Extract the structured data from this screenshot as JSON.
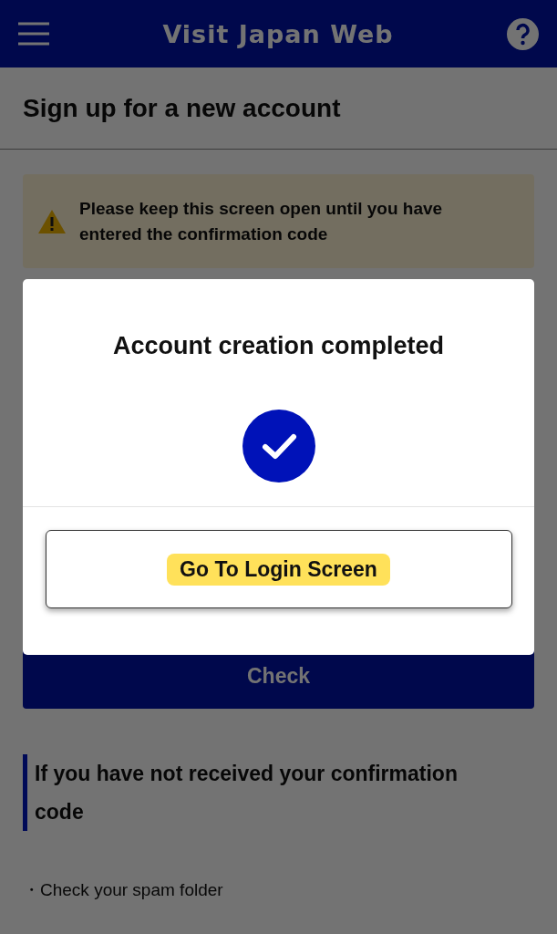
{
  "header": {
    "title": "Visit Japan Web"
  },
  "page": {
    "title": "Sign up for a new account"
  },
  "notice": {
    "text": "Please keep this screen open until you have entered the confirmation code"
  },
  "check_button": {
    "label": "Check"
  },
  "help_section": {
    "heading": "If you have not received your confirmation code",
    "items": [
      "・Check your spam folder"
    ]
  },
  "dialog": {
    "title": "Account creation completed",
    "button": {
      "label": "Go To Login Screen",
      "highlighted": true
    }
  }
}
